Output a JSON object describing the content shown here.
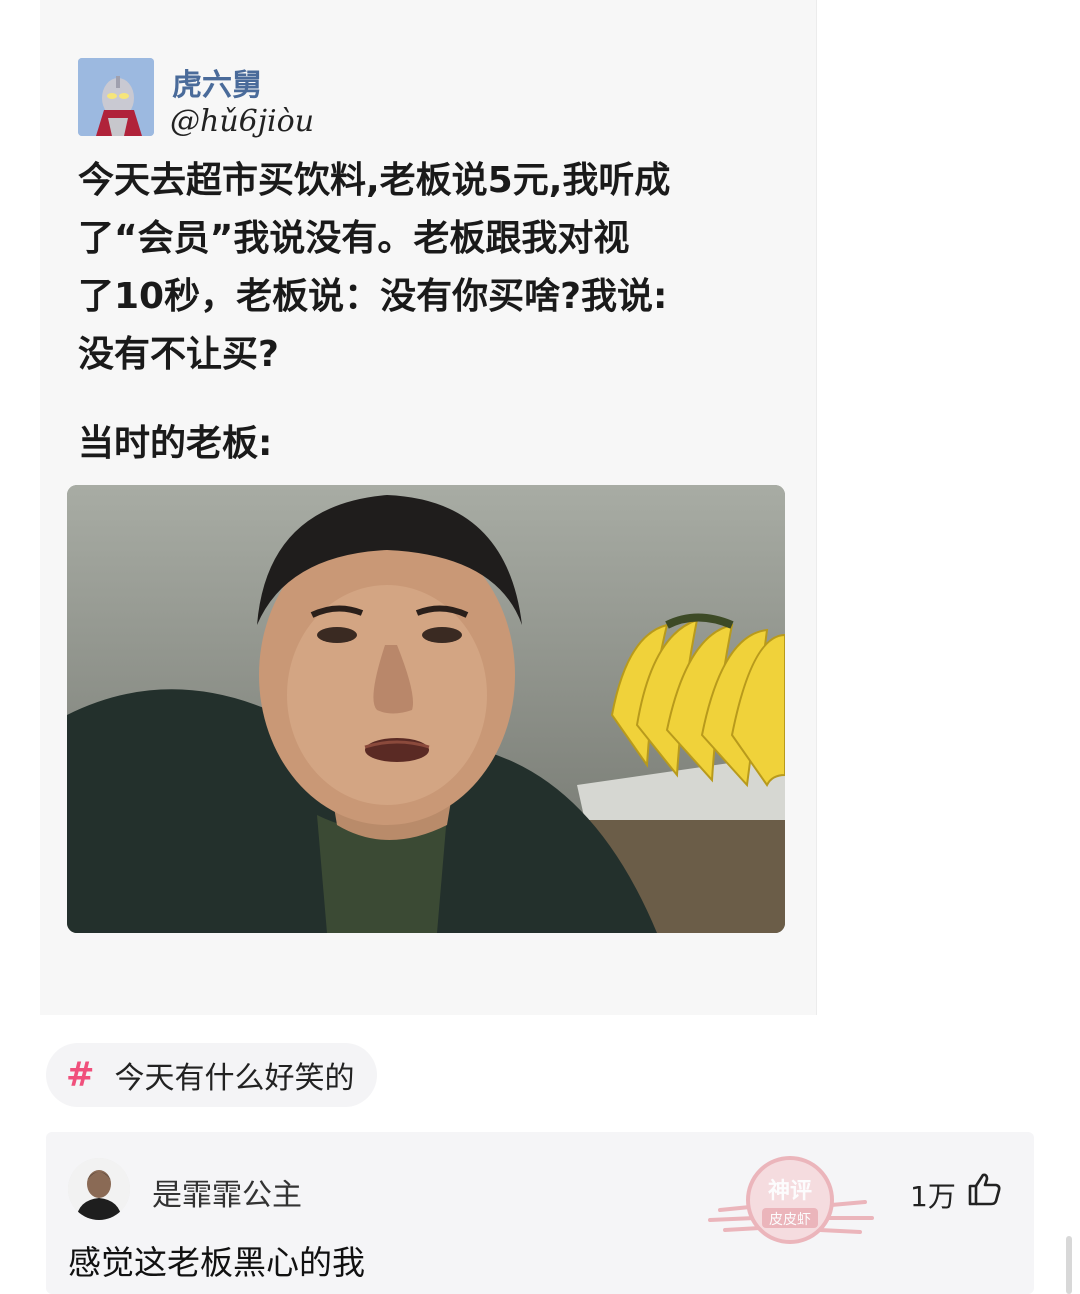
{
  "post": {
    "author_name": "虎六舅",
    "author_handle": "@hǔ6jiòu",
    "text": "今天去超市买饮料,老板说5元,我听成\n了“会员”我说没有。老板跟我对视\n了10秒，老板说：没有你买啥?我说:\n没有不让买?",
    "caption": "当时的老板:"
  },
  "topic": {
    "icon": "hash-icon",
    "label": "今天有什么好笑的"
  },
  "comment": {
    "user_name": "是霏霏公主",
    "text": "感觉这老板黑心的我",
    "like_count": "1万",
    "badge_text": "神评",
    "badge_subtext": "皮皮虾"
  },
  "colors": {
    "accent_pink": "#f0507c",
    "handle_blue": "#4a6b9a",
    "badge_red": "#e8a0a8"
  }
}
